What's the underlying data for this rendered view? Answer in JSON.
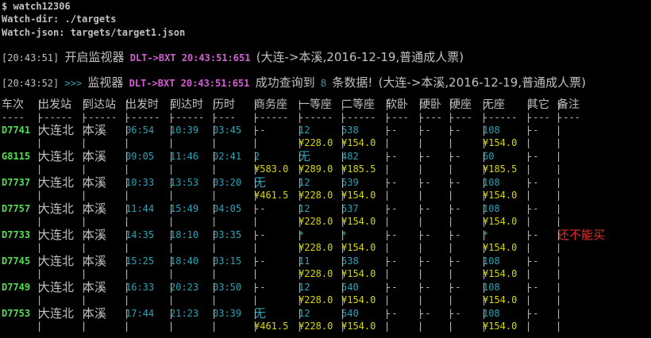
{
  "command": "$ watch12306",
  "watch_dir_label": "Watch-dir: ",
  "watch_dir_value": "./targets",
  "watch_json_label": "Watch-json: ",
  "watch_json_value": "targets/target1.json",
  "log1": {
    "time": "[20:43:51]",
    "text": "开启监视器",
    "route": "DLT->BXT 20:43:51:651",
    "query": "(大连->本溪,2016-12-19,普通成人票)"
  },
  "log2": {
    "time": "[20:43:52]",
    "arrows": ">>>",
    "text": "监视器",
    "route": "DLT->BXT 20:43:51:651",
    "success": "成功查询到",
    "count": "8",
    "count_suffix": "条数据!",
    "query": "(大连->本溪,2016-12-19,普通成人票)"
  },
  "headers": [
    "车次",
    "出发站",
    "到达站",
    "出发时",
    "到达时",
    "历时",
    "商务座",
    "一等座",
    "二等座",
    "软卧",
    "硬卧",
    "硬座",
    "无座",
    "其它",
    "备注"
  ],
  "header_underline": [
    "----",
    "------",
    "------",
    "------",
    "------",
    "----",
    "------",
    "------",
    "------",
    "----",
    "----",
    "----",
    "------",
    "----",
    "----"
  ],
  "rows": [
    {
      "train": "D7741",
      "from": "大连北",
      "to": "本溪",
      "dep": "06:54",
      "arr": "10:39",
      "dur": "03:45",
      "biz": "--",
      "first": "12",
      "second": "538",
      "soft": "--",
      "hard_sleep": "--",
      "hard_seat": "--",
      "none": "108",
      "other": "--",
      "note": "",
      "biz_price": "",
      "first_price": "¥228.0",
      "second_price": "¥154.0",
      "none_price": "¥154.0"
    },
    {
      "train": "G8115",
      "from": "大连北",
      "to": "本溪",
      "dep": "09:05",
      "arr": "11:46",
      "dur": "02:41",
      "biz": "2",
      "first": "无",
      "second": "482",
      "soft": "--",
      "hard_sleep": "--",
      "hard_seat": "--",
      "none": "60",
      "other": "--",
      "note": "",
      "biz_price": "¥583.0",
      "first_price": "¥289.0",
      "second_price": "¥185.5",
      "none_price": "¥185.5"
    },
    {
      "train": "D7737",
      "from": "大连北",
      "to": "本溪",
      "dep": "10:33",
      "arr": "13:53",
      "dur": "03:20",
      "biz": "无",
      "first": "12",
      "second": "539",
      "soft": "--",
      "hard_sleep": "--",
      "hard_seat": "--",
      "none": "108",
      "other": "--",
      "note": "",
      "biz_price": "¥461.5",
      "first_price": "¥228.0",
      "second_price": "¥154.0",
      "none_price": "¥154.0"
    },
    {
      "train": "D7757",
      "from": "大连北",
      "to": "本溪",
      "dep": "11:44",
      "arr": "15:49",
      "dur": "04:05",
      "biz": "--",
      "first": "12",
      "second": "537",
      "soft": "--",
      "hard_sleep": "--",
      "hard_seat": "--",
      "none": "108",
      "other": "--",
      "note": "",
      "biz_price": "",
      "first_price": "¥228.0",
      "second_price": "¥154.0",
      "none_price": "¥154.0"
    },
    {
      "train": "D7733",
      "from": "大连北",
      "to": "本溪",
      "dep": "14:35",
      "arr": "18:10",
      "dur": "03:35",
      "biz": "--",
      "first": "*",
      "second": "*",
      "soft": "--",
      "hard_sleep": "--",
      "hard_seat": "--",
      "none": "*",
      "other": "--",
      "note": "还不能买",
      "biz_price": "",
      "first_price": "¥228.0",
      "second_price": "¥154.0",
      "none_price": "¥154.0"
    },
    {
      "train": "D7745",
      "from": "大连北",
      "to": "本溪",
      "dep": "15:25",
      "arr": "18:40",
      "dur": "03:15",
      "biz": "--",
      "first": "11",
      "second": "538",
      "soft": "--",
      "hard_sleep": "--",
      "hard_seat": "--",
      "none": "108",
      "other": "--",
      "note": "",
      "biz_price": "",
      "first_price": "¥228.0",
      "second_price": "¥154.0",
      "none_price": "¥154.0"
    },
    {
      "train": "D7749",
      "from": "大连北",
      "to": "本溪",
      "dep": "16:33",
      "arr": "20:23",
      "dur": "03:50",
      "biz": "--",
      "first": "12",
      "second": "540",
      "soft": "--",
      "hard_sleep": "--",
      "hard_seat": "--",
      "none": "108",
      "other": "--",
      "note": "",
      "biz_price": "",
      "first_price": "¥228.0",
      "second_price": "¥154.0",
      "none_price": "¥154.0"
    },
    {
      "train": "D7753",
      "from": "大连北",
      "to": "本溪",
      "dep": "17:44",
      "arr": "21:23",
      "dur": "03:39",
      "biz": "无",
      "first": "12",
      "second": "540",
      "soft": "--",
      "hard_sleep": "--",
      "hard_seat": "--",
      "none": "108",
      "other": "--",
      "note": "",
      "biz_price": "¥461.5",
      "first_price": "¥228.0",
      "second_price": "¥154.0",
      "none_price": "¥154.0"
    }
  ]
}
